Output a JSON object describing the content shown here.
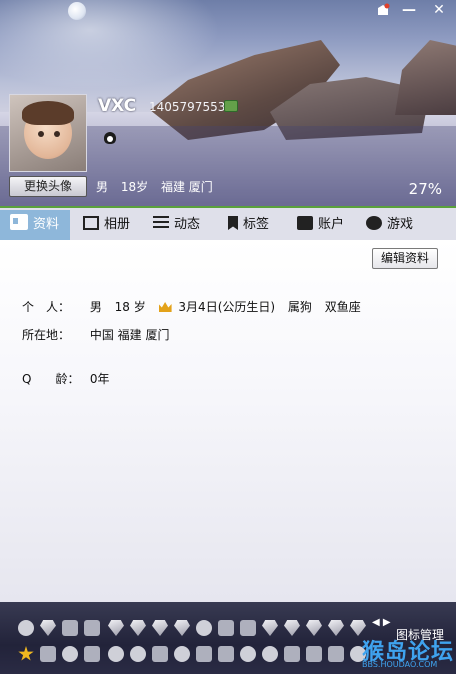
{
  "titlebar": {
    "skin_icon": "skin-icon",
    "min_label": "—",
    "close_label": "✕"
  },
  "profile": {
    "nickname": "VXC",
    "qq_number": "1405797553",
    "change_avatar_label": "更换头像",
    "gender": "男",
    "age": "18岁",
    "location": "福建 厦门",
    "completion": "27%"
  },
  "tabs": [
    {
      "label": "资料",
      "icon": "profile-card-icon",
      "active": true
    },
    {
      "label": "相册",
      "icon": "album-icon"
    },
    {
      "label": "动态",
      "icon": "feed-icon"
    },
    {
      "label": "标签",
      "icon": "tag-icon"
    },
    {
      "label": "账户",
      "icon": "wallet-icon"
    },
    {
      "label": "游戏",
      "icon": "game-icon"
    }
  ],
  "details": {
    "edit_button_label": "编辑资料",
    "personal_label": "个　人：",
    "personal_gender": "男",
    "personal_age": "18 岁",
    "birthday": "3月4日(公历生日)",
    "zodiac": "属狗",
    "constellation": "双鱼座",
    "location_label": "所在地：",
    "location_value": "中国 福建 厦门",
    "qage_label": "Q　　龄：",
    "qage_value": "0年"
  },
  "iconbar": {
    "manage_label": "图标管理",
    "arrows": "◀ ▶"
  },
  "watermark": {
    "text": "猴岛论坛",
    "url": "BBS.HOUDAO.COM"
  },
  "colors": {
    "tab_active": "#8eb7da",
    "accent_green": "#5aa23c",
    "iconbar_bg": "#22233a"
  }
}
